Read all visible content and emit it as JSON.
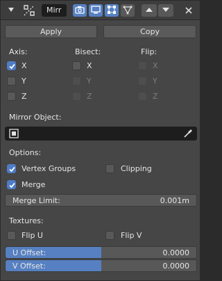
{
  "header": {
    "modifier_name": "Mirr"
  },
  "actions": {
    "apply_label": "Apply",
    "copy_label": "Copy"
  },
  "columns": {
    "axis_heading": "Axis:",
    "bisect_heading": "Bisect:",
    "flip_heading": "Flip:"
  },
  "axis": [
    {
      "label": "X",
      "checked": true
    },
    {
      "label": "Y",
      "checked": false
    },
    {
      "label": "Z",
      "checked": false
    }
  ],
  "bisect": [
    {
      "label": "X",
      "checked": false
    },
    {
      "label": "Y",
      "checked": false
    },
    {
      "label": "Z",
      "checked": false
    }
  ],
  "flip": [
    {
      "label": "X",
      "checked": false
    },
    {
      "label": "Y",
      "checked": false
    },
    {
      "label": "Z",
      "checked": false
    }
  ],
  "mirror_object": {
    "label": "Mirror Object:",
    "value": ""
  },
  "options": {
    "heading": "Options:",
    "vertex_groups_label": "Vertex Groups",
    "vertex_groups_checked": true,
    "clipping_label": "Clipping",
    "clipping_checked": false,
    "merge_label": "Merge",
    "merge_checked": true,
    "merge_limit_label": "Merge Limit:",
    "merge_limit_value": "0.001m"
  },
  "textures": {
    "heading": "Textures:",
    "flip_u_label": "Flip U",
    "flip_u_checked": false,
    "flip_v_label": "Flip V",
    "flip_v_checked": false,
    "u_offset_label": "U Offset:",
    "u_offset_value": "0.0000",
    "v_offset_label": "V Offset:",
    "v_offset_value": "0.0000"
  },
  "colors": {
    "accent": "#5680c2",
    "panel_bg": "#464646",
    "field_bg": "#1d1d1d"
  }
}
